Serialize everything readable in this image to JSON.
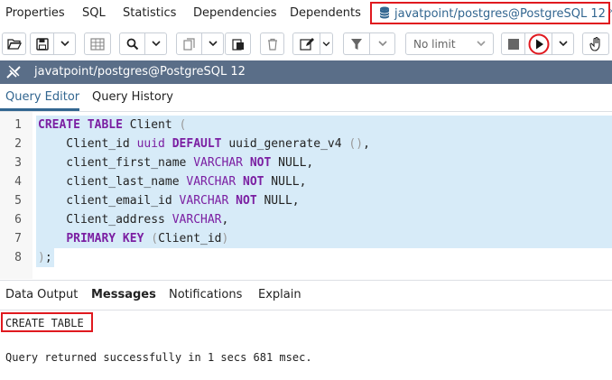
{
  "top_tabs": [
    "Properties",
    "SQL",
    "Statistics",
    "Dependencies",
    "Dependents"
  ],
  "active_tab": {
    "label": "javatpoint/postgres@PostgreSQL 12 *",
    "icon": "database-icon"
  },
  "toolbar": {
    "limit_label": "No limit",
    "icons": [
      "folder-open-icon",
      "save-icon",
      "grid-icon",
      "search-icon",
      "copy-icon",
      "paste-icon",
      "delete-icon",
      "edit-icon",
      "filter-icon",
      "stop-icon",
      "execute-icon",
      "hand-icon"
    ]
  },
  "connection": {
    "label": "javatpoint/postgres@PostgreSQL 12",
    "icon": "connection-icon"
  },
  "editor_tabs": [
    "Query Editor",
    "Query History"
  ],
  "editor": {
    "line_numbers": [
      "1",
      "2",
      "3",
      "4",
      "5",
      "6",
      "7",
      "8"
    ]
  },
  "output_tabs": [
    "Data Output",
    "Messages",
    "Notifications",
    "Explain"
  ],
  "messages": {
    "line1": "CREATE TABLE",
    "line2": "Query returned successfully in 1 secs 681 msec."
  },
  "colors": {
    "accent": "#326690",
    "highlight": "#e0191f",
    "connbar": "#5a6e88",
    "selection": "#d7ebf8"
  }
}
